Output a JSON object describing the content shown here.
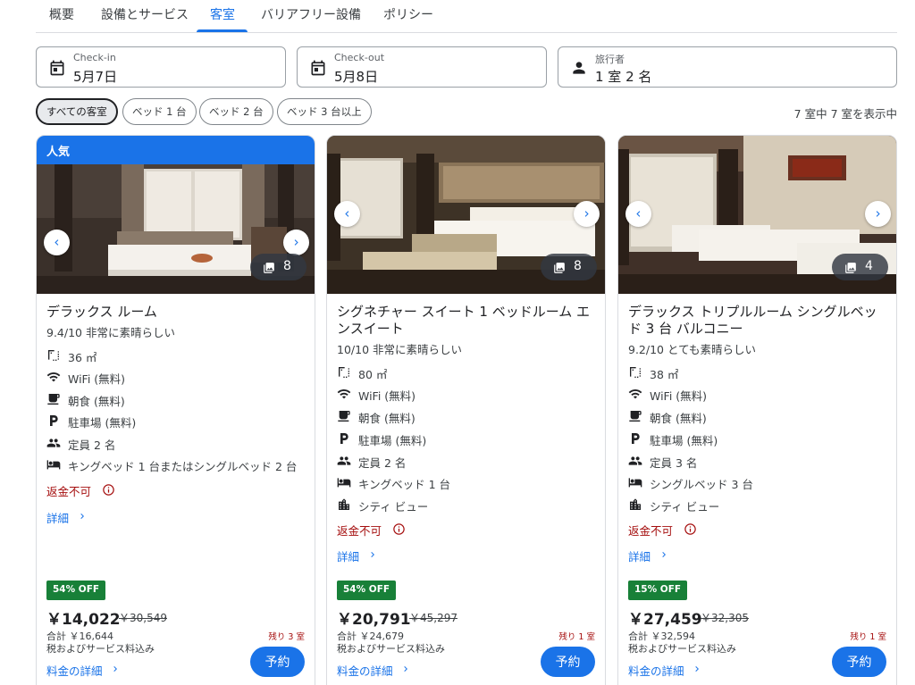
{
  "tabs": [
    {
      "label": "概要"
    },
    {
      "label": "設備とサービス"
    },
    {
      "label": "客室"
    },
    {
      "label": "バリアフリー設備"
    },
    {
      "label": "ポリシー"
    }
  ],
  "active_tab": "客室",
  "search": {
    "checkin": {
      "label": "Check-in",
      "value": "5月7日",
      "icon": "calendar-icon"
    },
    "checkout": {
      "label": "Check-out",
      "value": "5月8日",
      "icon": "calendar-icon"
    },
    "travelers": {
      "label": "旅行者",
      "value": "1 室 2 名",
      "icon": "person-icon"
    }
  },
  "filters": [
    {
      "label": "すべての客室",
      "selected": true
    },
    {
      "label": "ベッド 1 台",
      "selected": false
    },
    {
      "label": "ベッド 2 台",
      "selected": false
    },
    {
      "label": "ベッド 3 台以上",
      "selected": false
    }
  ],
  "result_count": "7 室中 7 室を表示中",
  "rooms": [
    {
      "badge": "人気",
      "photo_count": "8",
      "name": "デラックス ルーム",
      "rating": "9.4/10 非常に素晴らしい",
      "amenities": [
        {
          "icon": "floor-area-icon",
          "text": "36 ㎡"
        },
        {
          "icon": "wifi-icon",
          "text": "WiFi (無料)"
        },
        {
          "icon": "coffee-cup-icon",
          "text": "朝食 (無料)"
        },
        {
          "icon": "parking-icon",
          "text": "駐車場 (無料)"
        },
        {
          "icon": "people-icon",
          "text": "定員 2 名"
        },
        {
          "icon": "bed-icon",
          "text": "キングベッド 1 台またはシングルベッド 2 台"
        }
      ],
      "nonrefundable": "返金不可",
      "details": "詳細",
      "discount": "54% OFF",
      "price": "￥14,022",
      "original_price": "￥30,549",
      "total": "合計 ￥16,644",
      "tax_note": "税およびサービス料込み",
      "remaining": "残り 3 室",
      "price_details": "料金の詳細",
      "book": "予約"
    },
    {
      "badge": "",
      "photo_count": "8",
      "name": "シグネチャー スイート 1 ベッドルーム エンスイート",
      "rating": "10/10 非常に素晴らしい",
      "amenities": [
        {
          "icon": "floor-area-icon",
          "text": "80 ㎡"
        },
        {
          "icon": "wifi-icon",
          "text": "WiFi (無料)"
        },
        {
          "icon": "coffee-cup-icon",
          "text": "朝食 (無料)"
        },
        {
          "icon": "parking-icon",
          "text": "駐車場 (無料)"
        },
        {
          "icon": "people-icon",
          "text": "定員 2 名"
        },
        {
          "icon": "bed-icon",
          "text": "キングベッド 1 台"
        },
        {
          "icon": "city-icon",
          "text": "シティ ビュー"
        }
      ],
      "nonrefundable": "返金不可",
      "details": "詳細",
      "discount": "54% OFF",
      "price": "￥20,791",
      "original_price": "￥45,297",
      "total": "合計 ￥24,679",
      "tax_note": "税およびサービス料込み",
      "remaining": "残り 1 室",
      "price_details": "料金の詳細",
      "book": "予約"
    },
    {
      "badge": "",
      "photo_count": "4",
      "name": "デラックス トリプルルーム シングルベッド 3 台 バルコニー",
      "rating": "9.2/10 とても素晴らしい",
      "amenities": [
        {
          "icon": "floor-area-icon",
          "text": "38 ㎡"
        },
        {
          "icon": "wifi-icon",
          "text": "WiFi (無料)"
        },
        {
          "icon": "coffee-cup-icon",
          "text": "朝食 (無料)"
        },
        {
          "icon": "parking-icon",
          "text": "駐車場 (無料)"
        },
        {
          "icon": "people-icon",
          "text": "定員 3 名"
        },
        {
          "icon": "bed-icon",
          "text": "シングルベッド 3 台"
        },
        {
          "icon": "city-icon",
          "text": "シティ ビュー"
        }
      ],
      "nonrefundable": "返金不可",
      "details": "詳細",
      "discount": "15% OFF",
      "price": "￥27,459",
      "original_price": "￥32,305",
      "total": "合計 ￥32,594",
      "tax_note": "税およびサービス料込み",
      "remaining": "残り 1 室",
      "price_details": "料金の詳細",
      "book": "予約"
    }
  ],
  "colors": {
    "accent": "#1a73e8",
    "discount": "#188038",
    "warning": "#a50e0e"
  }
}
